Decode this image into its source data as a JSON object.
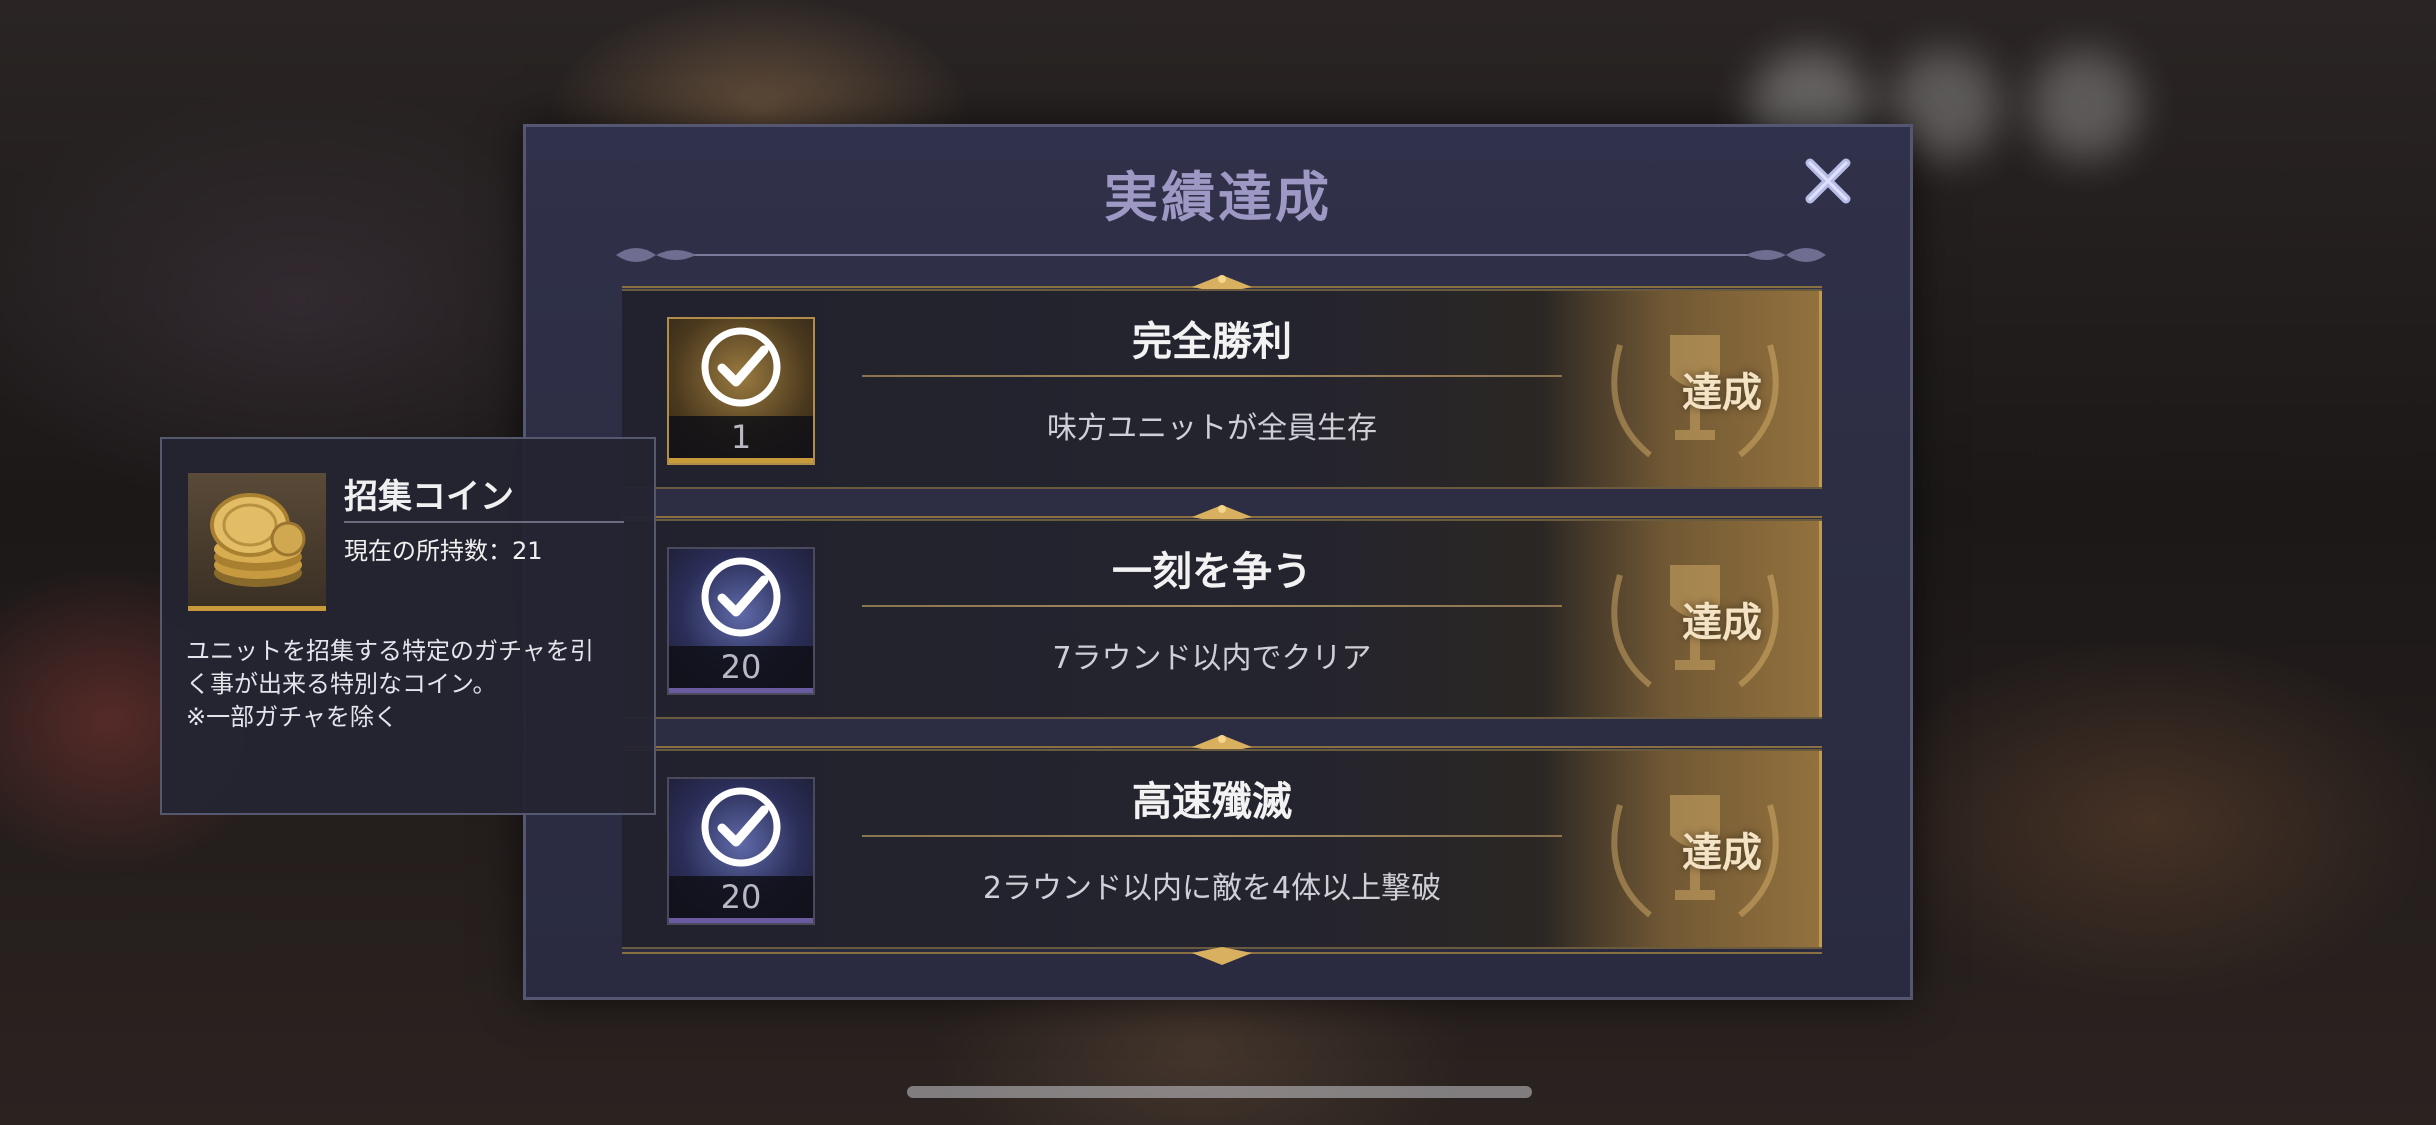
{
  "dialog": {
    "title": "実績達成",
    "close_icon": "close-icon"
  },
  "achievements": [
    {
      "title": "完全勝利",
      "description": "味方ユニットが全員生存",
      "reward_qty": "1",
      "reward_icon": "recruit-coin-check-icon",
      "status": "達成"
    },
    {
      "title": "一刻を争う",
      "description": "7ラウンド以内でクリア",
      "reward_qty": "20",
      "reward_icon": "crystal-check-icon",
      "status": "達成"
    },
    {
      "title": "高速殲滅",
      "description": "2ラウンド以内に敵を4体以上撃破",
      "reward_qty": "20",
      "reward_icon": "crystal-check-icon",
      "status": "達成"
    }
  ],
  "tooltip": {
    "item_name": "招集コイン",
    "owned": "現在の所持数：21",
    "description_lines": [
      "ユニットを招集する特定のガチャを引",
      "く事が出来る特別なコイン。",
      "※一部ガチャを除く"
    ],
    "icon": "gold-coins-icon"
  },
  "colors": {
    "panel": "#2d2e44",
    "title": "#9d99c4",
    "gold_accent": "#c79b3c",
    "achieved_text": "#f4e2c4"
  }
}
